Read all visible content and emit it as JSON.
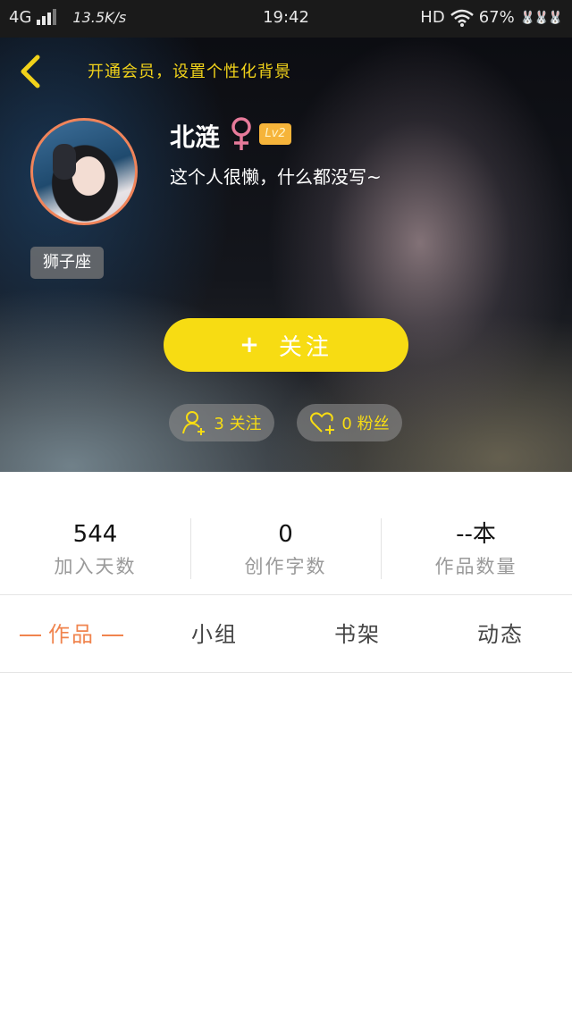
{
  "status_bar": {
    "network": "4G",
    "speed": "13.5K/s",
    "time": "19:42",
    "hd": "HD",
    "battery": "67%",
    "bunny": "🐰🐰🐰"
  },
  "header": {
    "vip_banner": "开通会员，设置个性化背景",
    "username": "北涟",
    "gender_symbol": "♀",
    "level": "Lv2",
    "bio": "这个人很懒，什么都没写~",
    "zodiac": "狮子座",
    "follow_plus": "+",
    "follow_label": "关注",
    "following_text": "3 关注",
    "fans_text": "0 粉丝",
    "colors": {
      "accent_yellow": "#f7dc13",
      "gender_pink": "#e77a9a",
      "avatar_border": "#f0845a"
    }
  },
  "stats": [
    {
      "value": "544",
      "label": "加入天数"
    },
    {
      "value": "0",
      "label": "创作字数"
    },
    {
      "value": "--本",
      "label": "作品数量"
    }
  ],
  "tabs": [
    {
      "label": "作品",
      "active": true
    },
    {
      "label": "小组",
      "active": false
    },
    {
      "label": "书架",
      "active": false
    },
    {
      "label": "动态",
      "active": false
    }
  ],
  "tab_active_color": "#f0844e"
}
